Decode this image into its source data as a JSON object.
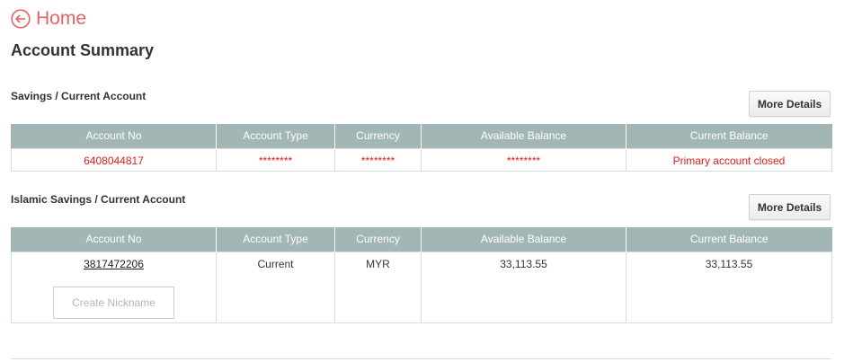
{
  "home": {
    "label": "Home"
  },
  "page": {
    "title": "Account Summary"
  },
  "columns": [
    "Account No",
    "Account Type",
    "Currency",
    "Available Balance",
    "Current Balance"
  ],
  "sections": [
    {
      "title": "Savings / Current Account",
      "more_details_label": "More Details",
      "row": {
        "account_no": "6408044817",
        "account_type": "********",
        "currency": "********",
        "available_balance": "********",
        "current_balance": "Primary account closed"
      }
    },
    {
      "title": "Islamic Savings / Current Account",
      "more_details_label": "More Details",
      "row": {
        "account_no": "3817472206",
        "nickname_placeholder": "Create Nickname",
        "account_type": "Current",
        "currency": "MYR",
        "available_balance": "33,113.55",
        "current_balance": "33,113.55"
      }
    }
  ],
  "colors": {
    "accent": "#e06468",
    "header_bg": "#a2b6b6",
    "alert_red": "#e01b1b"
  }
}
